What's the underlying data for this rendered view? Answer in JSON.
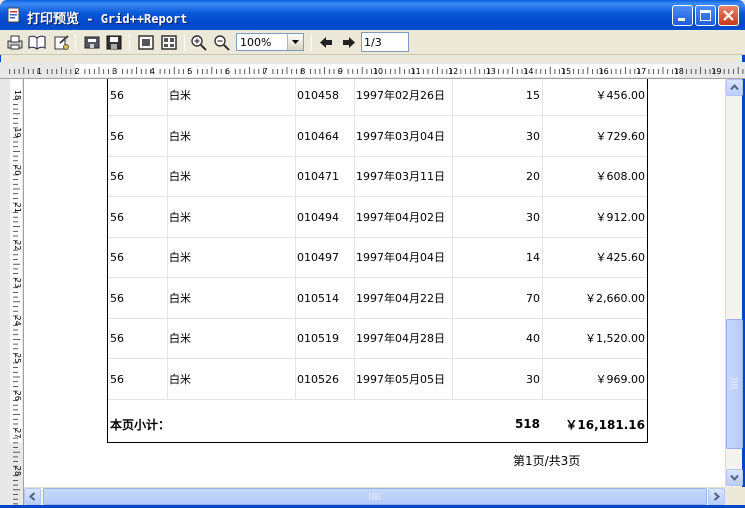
{
  "window": {
    "title_cn": "打印预览",
    "title_sep": " - ",
    "title_app": "Grid++Report"
  },
  "toolbar": {
    "zoom_value": "100%",
    "page_value": "1/3",
    "icons": [
      "print-icon",
      "book-icon",
      "page-setup-icon",
      "export-icon",
      "save-icon",
      "single-page-icon",
      "multi-page-icon",
      "zoom-in-icon",
      "zoom-out-icon",
      "prev-page-icon",
      "next-page-icon"
    ]
  },
  "hruler": {
    "labels": [
      "1",
      "2",
      "3",
      "4",
      "5",
      "6",
      "7",
      "8",
      "9",
      "10",
      "11",
      "12",
      "13",
      "14",
      "15",
      "16",
      "17",
      "18",
      "19",
      "20"
    ]
  },
  "vruler": {
    "labels": [
      "18",
      "19",
      "20",
      "21",
      "22",
      "23",
      "24",
      "25",
      "26",
      "27",
      "28"
    ]
  },
  "report": {
    "rows": [
      {
        "c1": "56",
        "c2": "白米",
        "c3": "010458",
        "c4": "1997年02月26日",
        "c5": "15",
        "c6": "￥456.00"
      },
      {
        "c1": "56",
        "c2": "白米",
        "c3": "010464",
        "c4": "1997年03月04日",
        "c5": "30",
        "c6": "￥729.60"
      },
      {
        "c1": "56",
        "c2": "白米",
        "c3": "010471",
        "c4": "1997年03月11日",
        "c5": "20",
        "c6": "￥608.00"
      },
      {
        "c1": "56",
        "c2": "白米",
        "c3": "010494",
        "c4": "1997年04月02日",
        "c5": "30",
        "c6": "￥912.00"
      },
      {
        "c1": "56",
        "c2": "白米",
        "c3": "010497",
        "c4": "1997年04月04日",
        "c5": "14",
        "c6": "￥425.60"
      },
      {
        "c1": "56",
        "c2": "白米",
        "c3": "010514",
        "c4": "1997年04月22日",
        "c5": "70",
        "c6": "￥2,660.00"
      },
      {
        "c1": "56",
        "c2": "白米",
        "c3": "010519",
        "c4": "1997年04月28日",
        "c5": "40",
        "c6": "￥1,520.00"
      },
      {
        "c1": "56",
        "c2": "白米",
        "c3": "010526",
        "c4": "1997年05月05日",
        "c5": "30",
        "c6": "￥969.00"
      }
    ],
    "subtotal_label": "本页小计：",
    "subtotal_qty": "518",
    "subtotal_amount": "￥16,181.16",
    "page_footer": "第1页/共3页"
  },
  "colors": {
    "titlebar": "#0757d6",
    "close": "#c8391a",
    "toolbar": "#ece9d8"
  }
}
